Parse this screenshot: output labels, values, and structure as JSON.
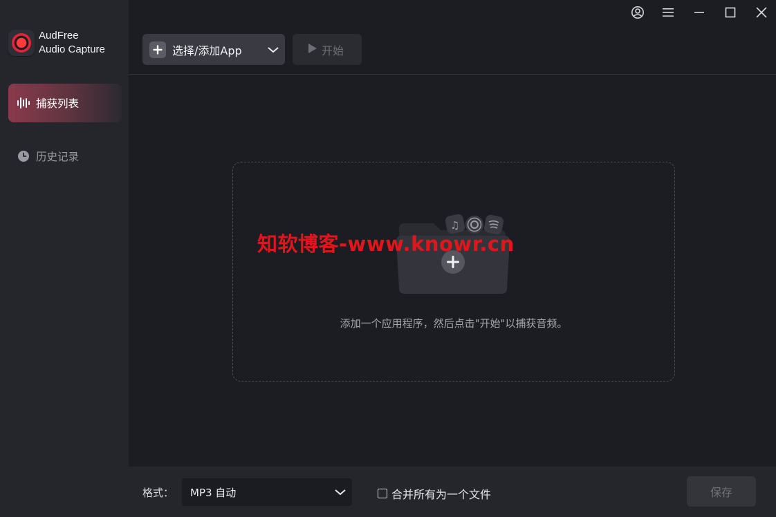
{
  "brand": {
    "line1": "AudFree",
    "line2": "Audio Capture"
  },
  "sidebar": {
    "items": [
      {
        "label": "捕获列表",
        "icon": "waveform-icon",
        "active": true
      },
      {
        "label": "历史记录",
        "icon": "clock-icon",
        "active": false
      }
    ]
  },
  "titlebar": {
    "icons": [
      "account-icon",
      "menu-icon",
      "minimize-icon",
      "maximize-icon",
      "close-icon"
    ]
  },
  "toolbar": {
    "select_app_label": "选择/添加App",
    "start_label": "开始"
  },
  "dropzone": {
    "hint": "添加一个应用程序，然后点击\"开始\"以捕获音频。"
  },
  "watermark": "知软博客-www.knowr.cn",
  "footer": {
    "format_label": "格式：",
    "format_value": "MP3 自动",
    "merge_label": "合并所有为一个文件",
    "save_label": "保存"
  },
  "colors": {
    "accent": "#8a3a4b",
    "watermark": "#e0161c",
    "background": "#1c1d22",
    "sidebar": "#25262c"
  }
}
